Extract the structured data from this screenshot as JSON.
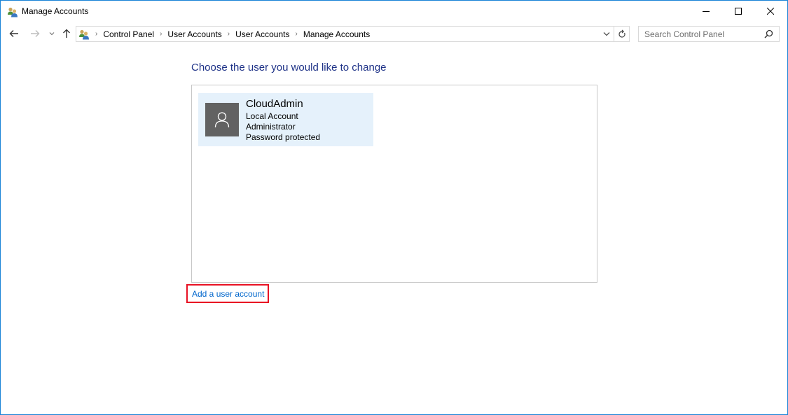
{
  "window": {
    "title": "Manage Accounts",
    "app_icon": "user-accounts-icon",
    "caption_buttons": [
      "minimize",
      "maximize",
      "close"
    ]
  },
  "navigation": {
    "back": "back-arrow-icon",
    "forward": "forward-arrow-icon",
    "recent": "chevron-down-icon",
    "up": "up-arrow-icon",
    "breadcrumb": [
      "Control Panel",
      "User Accounts",
      "User Accounts",
      "Manage Accounts"
    ],
    "refresh": "refresh-icon",
    "search_placeholder": "Search Control Panel"
  },
  "main": {
    "heading": "Choose the user you would like to change",
    "accounts": [
      {
        "name": "CloudAdmin",
        "type": "Local Account",
        "role": "Administrator",
        "status": "Password protected"
      }
    ],
    "add_user_link": "Add a user account",
    "highlight_color": "#e81123",
    "link_color": "#0066cc",
    "heading_color": "#1e3287"
  }
}
